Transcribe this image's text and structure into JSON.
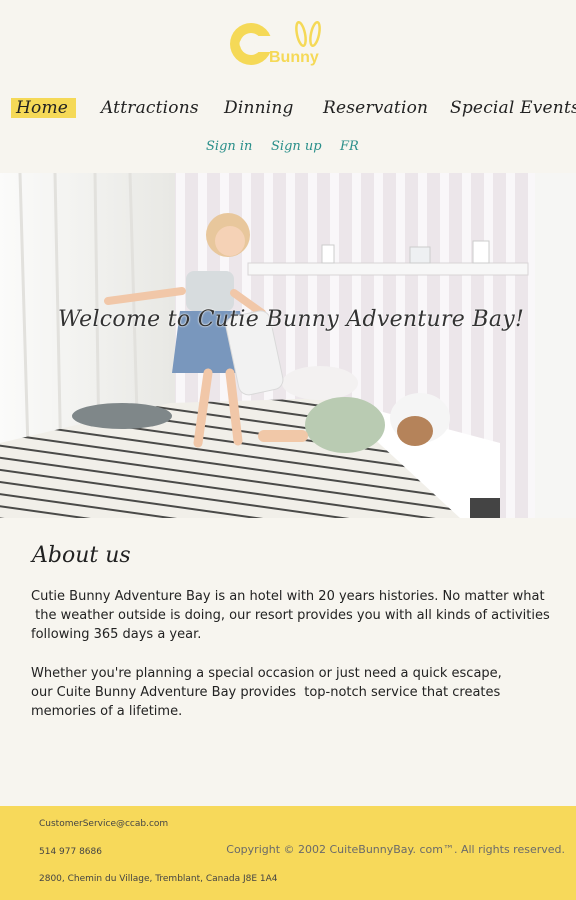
{
  "brand": {
    "logo_part1": "Cutie",
    "logo_part2": "Bunny",
    "accent_color": "#f5d957"
  },
  "nav": {
    "home": "Home",
    "attractions": "Attractions",
    "dinning": "Dinning",
    "reservation": "Reservation",
    "special_events": "Special Events"
  },
  "subnav": {
    "sign_in": "Sign in",
    "sign_up": "Sign up",
    "lang": "FR"
  },
  "hero": {
    "title": "Welcome to Cutie Bunny Adventure Bay!"
  },
  "about": {
    "heading": "About us",
    "p1_lines": [
      "Cutie Bunny Adventure Bay is an hotel with 20 years histories. No matter what",
      " the weather outside is doing, our resort provides you with all kinds of activities",
      "following 365 days a year."
    ],
    "p2_lines": [
      "Whether you're planning a special occasion or just need a quick escape,",
      "our Cuite Bunny Adventure Bay provides  top-notch service that creates",
      "memories of a lifetime."
    ]
  },
  "footer": {
    "email": "CustomerService@ccab.com",
    "phone": "514 977 8686",
    "address": "2800, Chemin du Village, Tremblant, Canada J8E 1A4",
    "copyright": "Copyright © 2002 CuiteBunnyBay. com™. All rights reserved."
  }
}
